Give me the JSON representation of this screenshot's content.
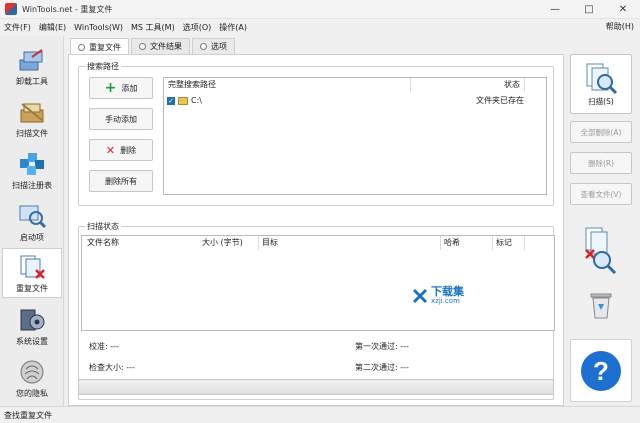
{
  "window": {
    "title": "WinTools.net - 重复文件"
  },
  "menu": {
    "items": [
      "文件(F)",
      "编辑(E)",
      "WinTools(W)",
      "MS 工具(M)",
      "选项(O)",
      "操作(A)"
    ],
    "help": "帮助(H)"
  },
  "sidebar": {
    "items": [
      {
        "label": "卸载工具",
        "icon": "uninstall-icon"
      },
      {
        "label": "扫描文件",
        "icon": "scan-files-icon"
      },
      {
        "label": "扫描注册表",
        "icon": "scan-registry-icon"
      },
      {
        "label": "启动项",
        "icon": "startup-icon"
      },
      {
        "label": "重复文件",
        "icon": "duplicate-files-icon"
      },
      {
        "label": "系统设置",
        "icon": "system-settings-icon"
      },
      {
        "label": "您的隐私",
        "icon": "privacy-icon"
      }
    ]
  },
  "tabs": [
    {
      "label": "重复文件"
    },
    {
      "label": "文件结果"
    },
    {
      "label": "选项"
    }
  ],
  "search_paths": {
    "title": "搜索路径",
    "buttons": {
      "add": "添加",
      "manual_add": "手动添加",
      "delete": "删除",
      "delete_all": "删除所有"
    },
    "columns": {
      "path": "完整搜索路径",
      "status": "状态"
    },
    "rows": [
      {
        "path": "C:\\",
        "status": "文件夹已存在",
        "checked": true
      }
    ]
  },
  "scan_status": {
    "title": "扫描状态",
    "columns": {
      "name": "文件名称",
      "size": "大小 (字节)",
      "target": "目标",
      "hash": "哈希",
      "mark": "标记"
    },
    "labels": {
      "checksum": "校准: ---",
      "check_size": "检查大小: ---",
      "first_pass": "第一次通过: ---",
      "second_pass": "第二次通过: ---"
    }
  },
  "right_buttons": {
    "scan": "扫描(S)",
    "delete_all": "全部删除(A)",
    "delete": "删除(R)",
    "view_file": "查看文件(V)"
  },
  "watermark": {
    "main": "下载集",
    "sub": "xzji.com"
  },
  "statusbar": {
    "text": "查找重复文件"
  }
}
